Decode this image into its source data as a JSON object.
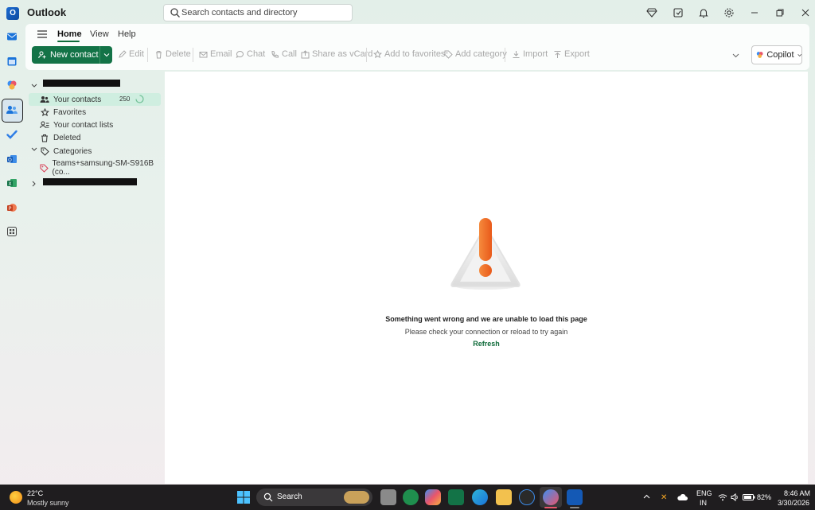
{
  "app": {
    "title": "Outlook"
  },
  "search": {
    "placeholder": "Search contacts and directory"
  },
  "tabs": [
    {
      "label": "Home"
    },
    {
      "label": "View"
    },
    {
      "label": "Help"
    }
  ],
  "ribbon": {
    "new_contact": "New contact",
    "edit": "Edit",
    "delete": "Delete",
    "email": "Email",
    "chat": "Chat",
    "call": "Call",
    "share_vcard": "Share as vCard",
    "add_favorites": "Add to favorites",
    "add_category": "Add category",
    "import": "Import",
    "export": "Export",
    "copilot": "Copilot"
  },
  "folders": {
    "your_contacts": "Your contacts",
    "your_contacts_count": "250",
    "favorites": "Favorites",
    "contact_lists": "Your contact lists",
    "deleted": "Deleted",
    "categories": "Categories",
    "category_item": "Teams+samsung-SM-S916B (co..."
  },
  "error": {
    "title": "Something went wrong and we are unable to load this page",
    "subtitle": "Please check your connection or reload to try again",
    "refresh": "Refresh"
  },
  "taskbar": {
    "temperature": "22°C",
    "weather": "Mostly sunny",
    "search": "Search",
    "lang_top": "ENG",
    "lang_bottom": "IN",
    "battery": "82%",
    "time": "8:46 AM",
    "date": "3/30/2026"
  },
  "colors": {
    "accent": "#137347",
    "selected": "#cfeee0",
    "warning": "#f06a1f"
  }
}
